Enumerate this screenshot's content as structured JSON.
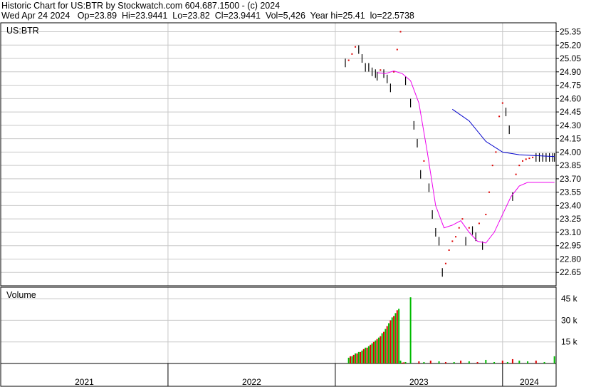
{
  "header": {
    "line1": "Historic Chart for US:BTR by Stockwatch.com 604.687.1500 - (c) 2024",
    "date": "Wed Apr 24 2024",
    "open": "Op=23.89",
    "high": "Hi=23.9441",
    "low": "Lo=23.82",
    "close": "Cl=23.9441",
    "volume": "Vol=5,426",
    "year_high": "Year hi=25.41",
    "year_low": "lo=22.5738"
  },
  "colors": {
    "price_bar": "#000000",
    "up_marker": "#dd0000",
    "ma_short": "#ee00ee",
    "ma_long": "#0000cc",
    "vol_up": "#00bb00",
    "vol_down": "#dd0000",
    "grid": "#c8c8c8"
  },
  "chart_data": {
    "type": "line",
    "title": "Historic Chart for US:BTR by Stockwatch.com 604.687.1500 - (c) 2024",
    "price_panel": {
      "label": "US:BTR",
      "ylim": [
        22.5,
        25.45
      ],
      "y_ticks": [
        "25.35",
        "25.20",
        "25.05",
        "24.90",
        "24.75",
        "24.60",
        "24.45",
        "24.30",
        "24.15",
        "24.00",
        "23.85",
        "23.70",
        "23.55",
        "23.40",
        "23.25",
        "23.10",
        "22.95",
        "22.80",
        "22.65"
      ],
      "x_range": [
        2021.0,
        2024.32
      ],
      "price": {
        "x": [
          2023.06,
          2023.08,
          2023.1,
          2023.12,
          2023.14,
          2023.16,
          2023.18,
          2023.2,
          2023.22,
          2023.24,
          2023.25,
          2023.27,
          2023.29,
          2023.31,
          2023.33,
          2023.35,
          2023.37,
          2023.39,
          2023.42,
          2023.45,
          2023.47,
          2023.49,
          2023.51,
          2023.53,
          2023.56,
          2023.58,
          2023.6,
          2023.62,
          2023.64,
          2023.66,
          2023.68,
          2023.7,
          2023.72,
          2023.74,
          2023.76,
          2023.78,
          2023.8,
          2023.82,
          2023.84,
          2023.86,
          2023.88,
          2023.9,
          2023.92,
          2023.94,
          2023.96,
          2023.98,
          2024.0,
          2024.02,
          2024.04,
          2024.06,
          2024.08,
          2024.1,
          2024.12,
          2024.14,
          2024.16,
          2024.18,
          2024.2,
          2024.22,
          2024.24,
          2024.26,
          2024.28,
          2024.3,
          2024.31
        ],
        "values": [
          25.0,
          25.03,
          25.1,
          25.18,
          25.15,
          25.05,
          24.95,
          24.95,
          24.9,
          24.88,
          24.85,
          24.92,
          24.88,
          24.82,
          24.72,
          24.9,
          25.15,
          25.35,
          24.8,
          24.55,
          24.3,
          24.1,
          23.75,
          23.9,
          23.6,
          23.3,
          23.1,
          23.0,
          22.65,
          22.75,
          22.9,
          23.0,
          23.05,
          23.15,
          23.25,
          23.0,
          23.15,
          23.12,
          23.05,
          23.2,
          22.95,
          23.3,
          23.55,
          23.85,
          24.0,
          24.4,
          24.55,
          24.45,
          24.25,
          23.5,
          23.75,
          23.85,
          23.9,
          23.92,
          23.93,
          23.94,
          23.94,
          23.94,
          23.94,
          23.94,
          23.94,
          23.94,
          23.94
        ]
      },
      "ma_short": {
        "x": [
          2023.25,
          2023.3,
          2023.35,
          2023.4,
          2023.45,
          2023.5,
          2023.55,
          2023.6,
          2023.65,
          2023.7,
          2023.75,
          2023.8,
          2023.85,
          2023.9,
          2023.95,
          2024.0,
          2024.05,
          2024.1,
          2024.15,
          2024.2,
          2024.25,
          2024.31
        ],
        "values": [
          24.89,
          24.88,
          24.91,
          24.88,
          24.8,
          24.55,
          24.0,
          23.4,
          23.15,
          23.18,
          23.23,
          23.1,
          23.0,
          22.98,
          23.1,
          23.3,
          23.5,
          23.62,
          23.66,
          23.66,
          23.66,
          23.66
        ]
      },
      "ma_long": {
        "x": [
          2023.7,
          2023.8,
          2023.9,
          2024.0,
          2024.1,
          2024.2,
          2024.31
        ],
        "values": [
          24.48,
          24.35,
          24.12,
          24.0,
          23.97,
          23.96,
          23.95
        ]
      }
    },
    "volume_panel": {
      "label": "Volume",
      "ylim": [
        0,
        53
      ],
      "y_ticks": [
        "45 k",
        "30 k",
        "15 k"
      ],
      "x": [
        2023.08,
        2023.09,
        2023.1,
        2023.11,
        2023.12,
        2023.13,
        2023.14,
        2023.15,
        2023.16,
        2023.17,
        2023.18,
        2023.19,
        2023.2,
        2023.21,
        2023.22,
        2023.23,
        2023.24,
        2023.25,
        2023.26,
        2023.27,
        2023.28,
        2023.29,
        2023.3,
        2023.31,
        2023.32,
        2023.33,
        2023.34,
        2023.35,
        2023.36,
        2023.37,
        2023.38,
        2023.39,
        2023.4,
        2023.41,
        2023.42,
        2023.45,
        2023.5,
        2023.53,
        2023.57,
        2023.62,
        2023.66,
        2023.71,
        2023.75,
        2023.8,
        2023.85,
        2023.9,
        2023.95,
        2024.0,
        2024.03,
        2024.06,
        2024.1,
        2024.15,
        2024.2,
        2024.25,
        2024.31
      ],
      "values": [
        4,
        5,
        5,
        6,
        7,
        7,
        8,
        8,
        9,
        10,
        11,
        11,
        12,
        13,
        14,
        15,
        16,
        17,
        18,
        19,
        21,
        22,
        24,
        26,
        28,
        30,
        32,
        33,
        35,
        37,
        38,
        2,
        0.6,
        0.8,
        1.0,
        46,
        1.5,
        1.0,
        2.0,
        1.5,
        1.0,
        1.0,
        2.0,
        1.5,
        1.0,
        2.5,
        1.0,
        2.0,
        1.0,
        3.0,
        2.0,
        1.5,
        2.0,
        1.0,
        5.0
      ],
      "up": [
        1,
        0,
        1,
        0,
        1,
        0,
        1,
        0,
        1,
        0,
        1,
        0,
        1,
        0,
        1,
        0,
        1,
        0,
        1,
        0,
        1,
        0,
        1,
        0,
        1,
        0,
        1,
        0,
        1,
        0,
        1,
        1,
        0,
        0,
        1,
        1,
        0,
        1,
        0,
        1,
        0,
        1,
        0,
        1,
        0,
        1,
        1,
        0,
        1,
        0,
        1,
        1,
        0,
        1,
        1
      ]
    },
    "x_axis": {
      "labels": [
        "2021",
        "2022",
        "2023",
        "2024"
      ],
      "boundaries": [
        2021.0,
        2022.0,
        2023.0,
        2024.0
      ]
    }
  }
}
